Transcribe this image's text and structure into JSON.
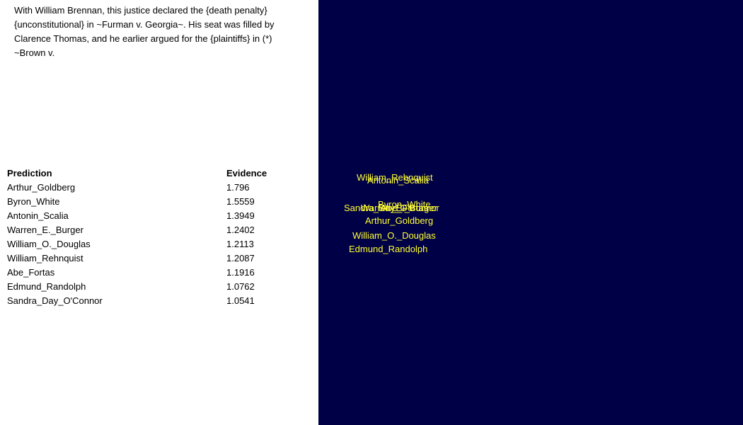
{
  "question": {
    "text": "With William Brennan, this justice declared the {death penalty} {unconstitutional} in ~Furman v. Georgia~. His seat was filled by Clarence Thomas, and he earlier argued for the {plaintiffs} in (*) ~Brown v."
  },
  "predictions": {
    "header_prediction": "Prediction",
    "header_evidence": "Evidence",
    "rows": [
      {
        "name": "Arthur_Goldberg",
        "evidence": "1.796"
      },
      {
        "name": "Byron_White",
        "evidence": "1.5559"
      },
      {
        "name": "Antonin_Scalia",
        "evidence": "1.3949"
      },
      {
        "name": "Warren_E._Burger",
        "evidence": "1.2402"
      },
      {
        "name": "William_O._Douglas",
        "evidence": "1.2113"
      },
      {
        "name": "William_Rehnquist",
        "evidence": "1.2087"
      },
      {
        "name": "Abe_Fortas",
        "evidence": "1.1916"
      },
      {
        "name": "Edmund_Randolph",
        "evidence": "1.0762"
      },
      {
        "name": "Sandra_Day_O'Connor",
        "evidence": "1.0541"
      }
    ]
  },
  "cloud": {
    "background": "#000047",
    "label_color": "#ffff33",
    "labels": [
      "William_Rehnquist",
      "Antonin_Scalia",
      "Byron_White",
      "Sandra_Day_O'Connor",
      "Warren_E._Burger",
      "Abe_Fortas",
      "Arthur_Goldberg",
      "William_O._Douglas",
      "Edmund_Randolph"
    ]
  }
}
